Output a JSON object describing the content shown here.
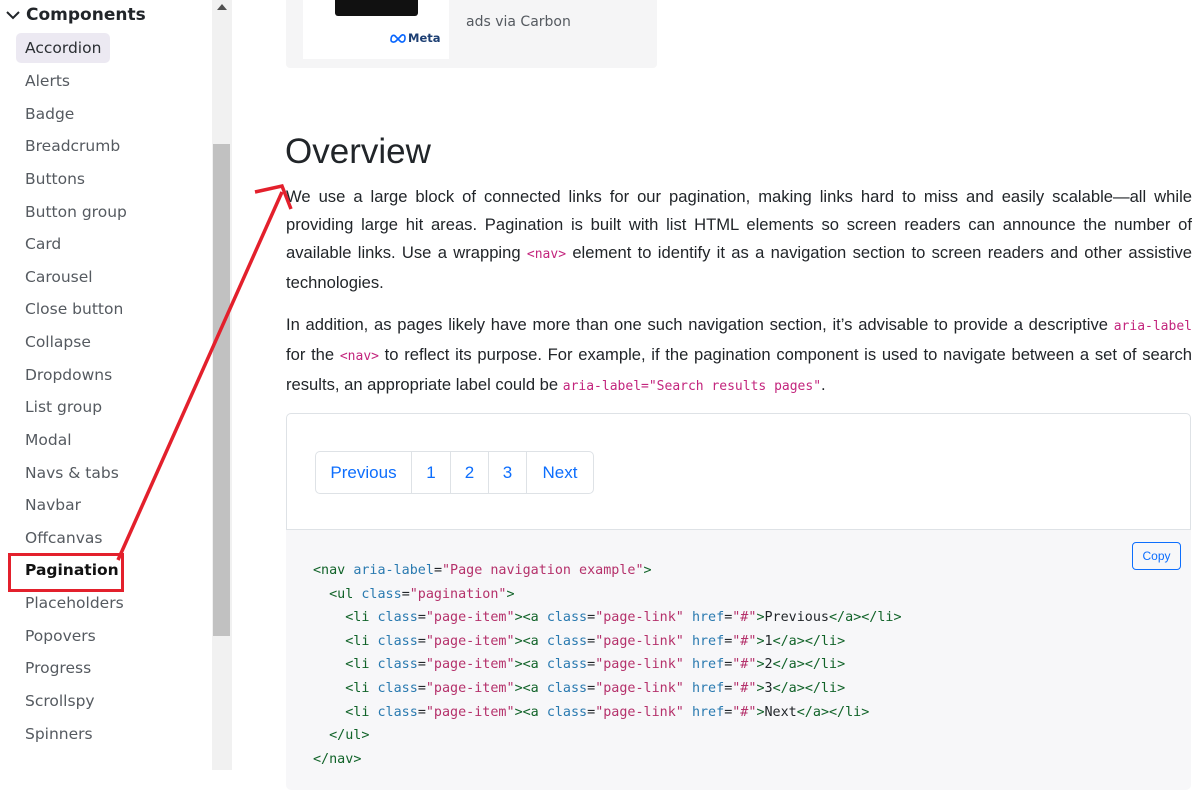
{
  "sidebar": {
    "section_title": "Components",
    "items": [
      {
        "label": "Accordion"
      },
      {
        "label": "Alerts"
      },
      {
        "label": "Badge"
      },
      {
        "label": "Breadcrumb"
      },
      {
        "label": "Buttons"
      },
      {
        "label": "Button group"
      },
      {
        "label": "Card"
      },
      {
        "label": "Carousel"
      },
      {
        "label": "Close button"
      },
      {
        "label": "Collapse"
      },
      {
        "label": "Dropdowns"
      },
      {
        "label": "List group"
      },
      {
        "label": "Modal"
      },
      {
        "label": "Navs & tabs"
      },
      {
        "label": "Navbar"
      },
      {
        "label": "Offcanvas"
      },
      {
        "label": "Pagination"
      },
      {
        "label": "Placeholders"
      },
      {
        "label": "Popovers"
      },
      {
        "label": "Progress"
      },
      {
        "label": "Scrollspy"
      },
      {
        "label": "Spinners"
      }
    ],
    "hovered_item": "Accordion",
    "current_item": "Pagination"
  },
  "ad": {
    "brand": "Meta",
    "text": "ads via Carbon"
  },
  "overview": {
    "heading": "Overview",
    "p1_part1": "We use a large block of connected links for our pagination, making links hard to miss and easily scalable—all while providing large hit areas. Pagination is built with list HTML elements so screen readers can announce the number of available links. Use a wrapping ",
    "p1_code": "<nav>",
    "p1_part2": " element to identify it as a navigation section to screen readers and other assistive technologies.",
    "p2_part1": "In addition, as pages likely have more than one such navigation section, it’s advisable to provide a descriptive ",
    "p2_code1": "aria-label",
    "p2_part2": " for the ",
    "p2_code2": "<nav>",
    "p2_part3": " to reflect its purpose. For example, if the pagination component is used to navigate between a set of search results, an appropriate label could be ",
    "p2_code3": "aria-label=\"Search results pages\"",
    "p2_part4": "."
  },
  "example": {
    "pages": [
      "Previous",
      "1",
      "2",
      "3",
      "Next"
    ]
  },
  "code": {
    "copy_label": "Copy",
    "lines": [
      "<nav aria-label=\"Page navigation example\">",
      "  <ul class=\"pagination\">",
      "    <li class=\"page-item\"><a class=\"page-link\" href=\"#\">Previous</a></li>",
      "    <li class=\"page-item\"><a class=\"page-link\" href=\"#\">1</a></li>",
      "    <li class=\"page-item\"><a class=\"page-link\" href=\"#\">2</a></li>",
      "    <li class=\"page-item\"><a class=\"page-link\" href=\"#\">3</a></li>",
      "    <li class=\"page-item\"><a class=\"page-link\" href=\"#\">Next</a></li>",
      "  </ul>",
      "</nav>"
    ]
  },
  "colors": {
    "annotation_red": "#e3202c",
    "link_blue": "#0d6efd",
    "code_pink": "#c3257d"
  }
}
